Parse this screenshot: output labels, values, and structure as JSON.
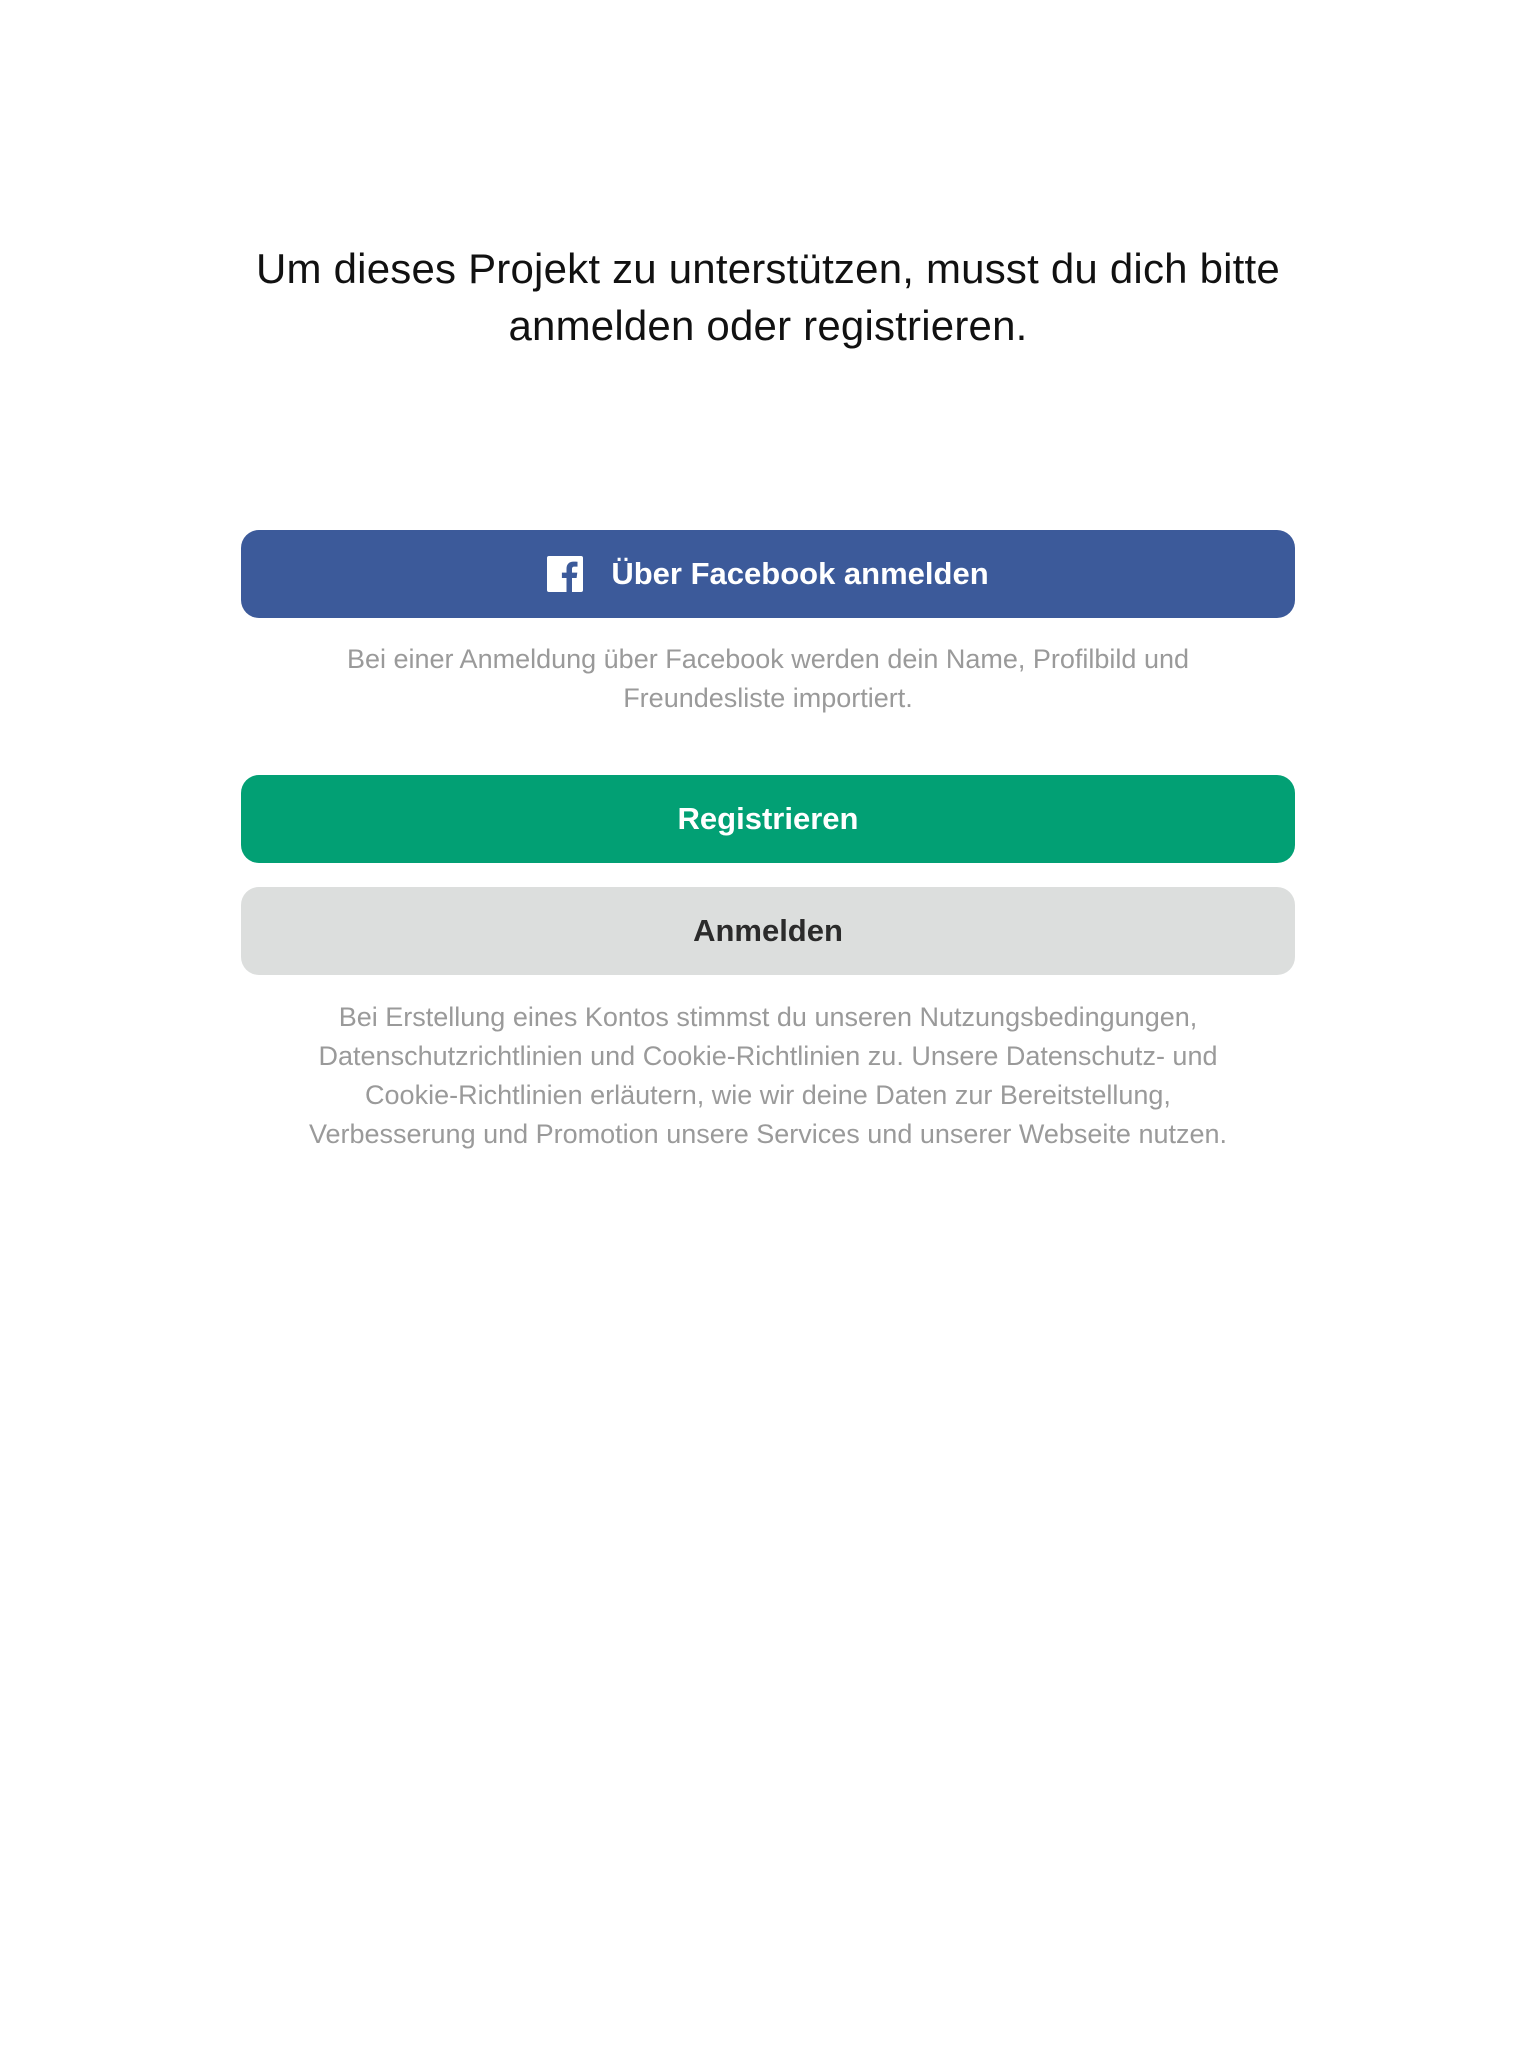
{
  "prompt": {
    "line1": "Um dieses Projekt zu unterstützen, musst du dich bitte",
    "line2": "anmelden oder registrieren."
  },
  "facebook_login": {
    "label": "Über Facebook anmelden",
    "icon": "facebook-icon",
    "color": "#3c5a9a",
    "note_line1": "Bei einer Anmeldung über Facebook werden dein Name, Profilbild und",
    "note_line2": "Freundesliste importiert."
  },
  "register": {
    "label": "Registrieren",
    "color": "#02a074"
  },
  "login": {
    "label": "Anmelden",
    "color": "#dcdedd"
  },
  "terms": {
    "line1": "Bei Erstellung eines Kontos stimmst du unseren Nutzungsbedingungen,",
    "line2": "Datenschutzrichtlinien und Cookie-Richtlinien zu. Unsere Datenschutz- und",
    "line3": "Cookie-Richtlinien erläutern, wie wir deine Daten zur Bereitstellung,",
    "line4": "Verbesserung und Promotion unsere Services und unserer Webseite nutzen."
  }
}
